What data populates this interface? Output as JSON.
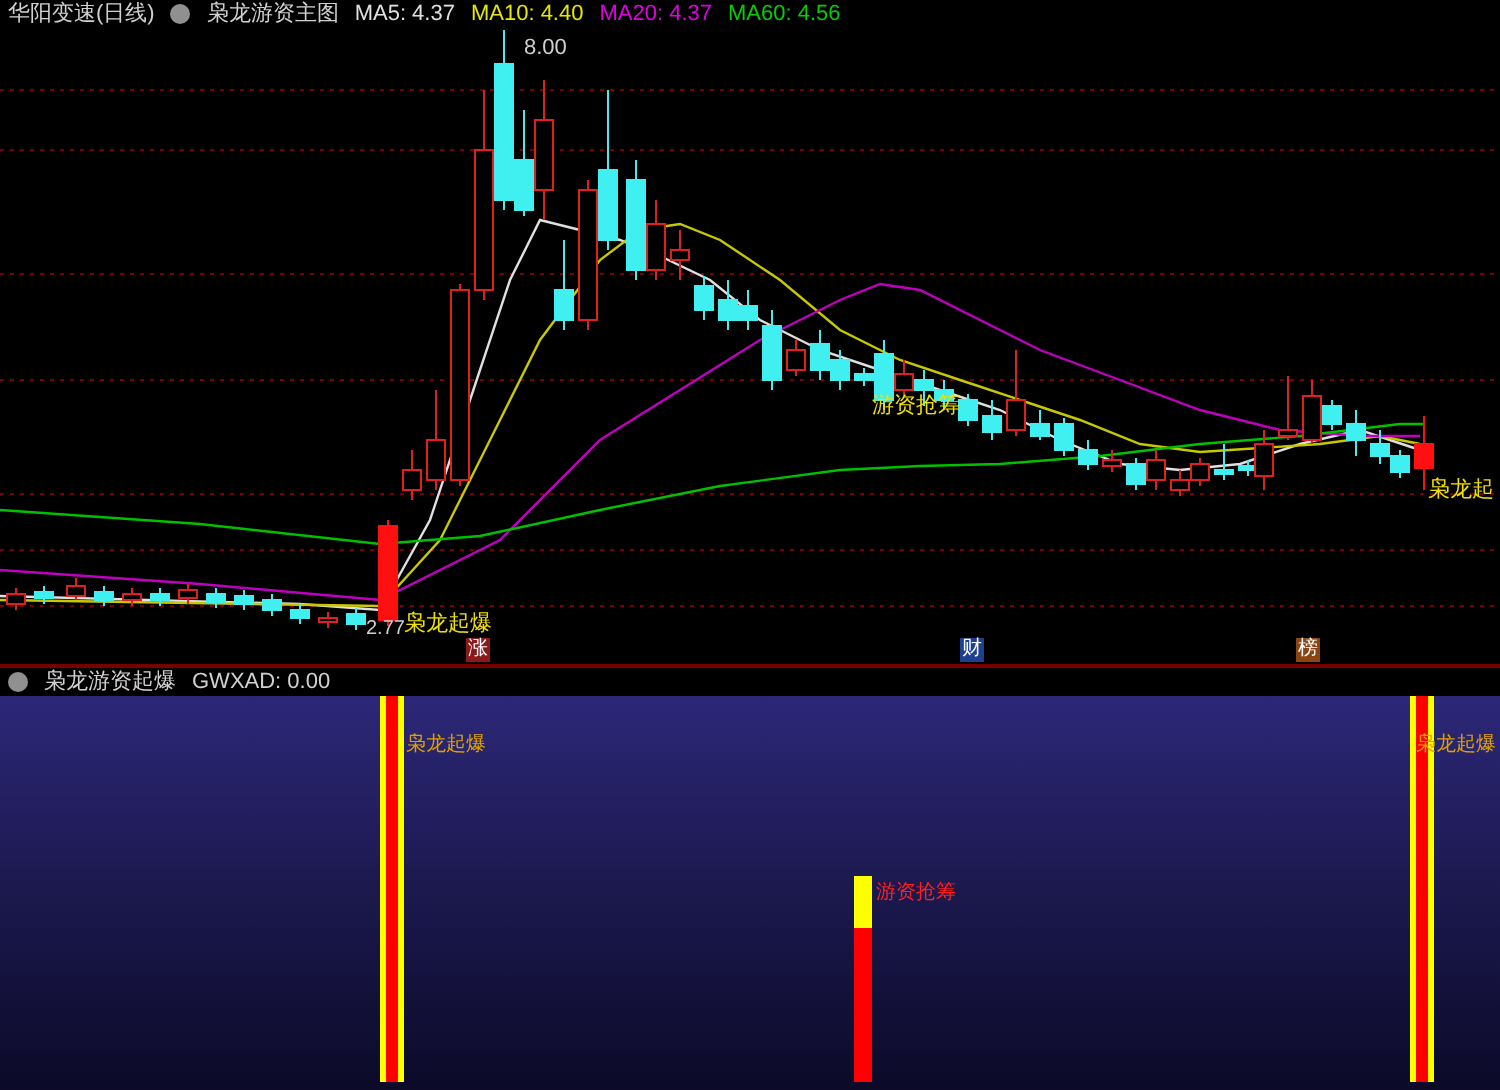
{
  "main_chart": {
    "stock": "华阳变速(日线)",
    "indicator": "枭龙游资主图",
    "ma_readings": [
      {
        "label": "MA5: 4.37",
        "color": "#e0e0e0"
      },
      {
        "label": "MA10: 4.40",
        "color": "#e6e600"
      },
      {
        "label": "MA20: 4.37",
        "color": "#e000e0"
      },
      {
        "label": "MA60: 4.56",
        "color": "#00d000"
      }
    ],
    "high_label": "8.00",
    "low_label": "2.77",
    "signals": [
      "枭龙起爆",
      "游资抢筹",
      "枭龙起"
    ]
  },
  "markers": [
    {
      "text": "涨",
      "color": "#8b1a1a"
    },
    {
      "text": "财",
      "color": "#1f3f8f"
    },
    {
      "text": "榜",
      "color": "#8b4513"
    }
  ],
  "sub_chart": {
    "indicator": "枭龙游资起爆",
    "reading": "GWXAD: 0.00",
    "signals": [
      {
        "text": "枭龙起爆",
        "kind": "breakout"
      },
      {
        "text": "游资抢筹",
        "kind": "inflow"
      },
      {
        "text": "枭龙起爆",
        "kind": "breakout"
      }
    ]
  }
}
